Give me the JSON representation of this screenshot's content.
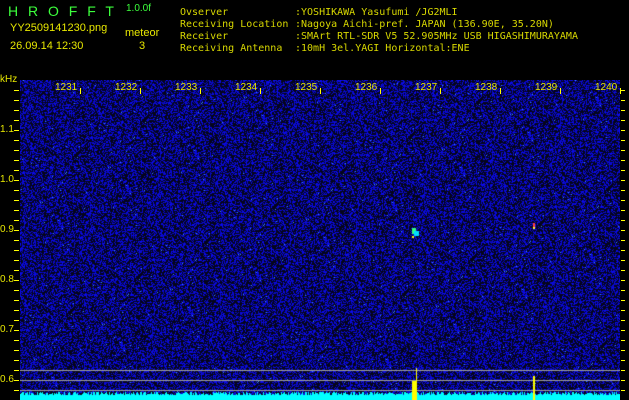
{
  "header": {
    "title_letters": "H R O F F T",
    "version": "1.0.0f",
    "filename": "YY2509141230.png",
    "datetime": "26.09.14 12:30",
    "meteor_label": "meteor",
    "meteor_count": "3"
  },
  "info": [
    {
      "label": "Ovserver",
      "value": ":YOSHIKAWA Yasufumi /JG2MLI"
    },
    {
      "label": "Receiving Location",
      "value": ":Nagoya Aichi-pref. JAPAN (136.90E, 35.20N)"
    },
    {
      "label": "Receiver",
      "value": ":SMArt RTL-SDR V5 52.905MHz USB HIGASHIMURAYAMA"
    },
    {
      "label": "Receiving Antenna",
      "value": ":10mH 3el.YAGI Horizontal:ENE"
    }
  ],
  "axis": {
    "unit": "kHz",
    "time_labels": [
      "1231",
      "1232",
      "1233",
      "1234",
      "1235",
      "1236",
      "1237",
      "1238",
      "1239",
      "1240"
    ],
    "freq_labels": [
      "1.1",
      "1.0",
      "0.9",
      "0.8",
      "0.7",
      "0.6"
    ]
  },
  "colors": {
    "background": "#000000",
    "noise": "#1a22c8",
    "baseline": "#00ffff",
    "echo": "#ffff00",
    "label": "#e8e800",
    "title": "#3cff3c"
  }
}
